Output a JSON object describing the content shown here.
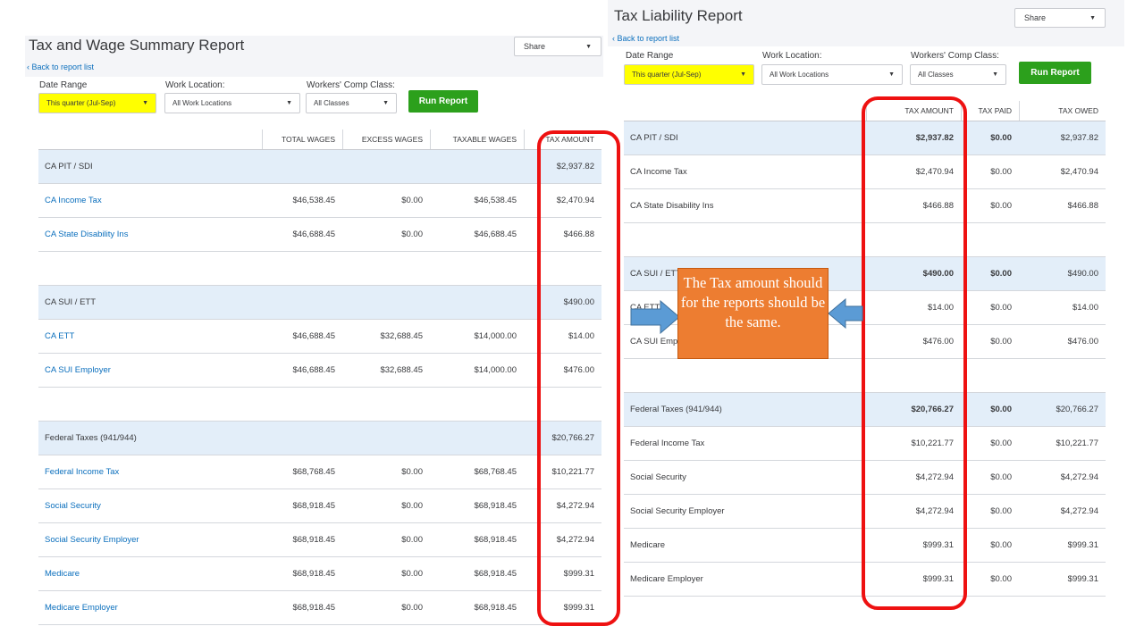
{
  "left": {
    "title": "Tax and Wage Summary Report",
    "back": "Back to report list",
    "share": "Share",
    "filters": {
      "date_label": "Date Range",
      "date_value": "This quarter (Jul-Sep)",
      "loc_label": "Work Location:",
      "loc_value": "All Work Locations",
      "comp_label": "Workers' Comp Class:",
      "comp_value": "All Classes",
      "run": "Run Report"
    },
    "columns": [
      "TOTAL WAGES",
      "EXCESS WAGES",
      "TAXABLE WAGES",
      "TAX AMOUNT"
    ],
    "rows": [
      {
        "type": "group",
        "name": "CA PIT / SDI",
        "vals": [
          "",
          "",
          "",
          "$2,937.82"
        ]
      },
      {
        "type": "item",
        "name": "CA Income Tax",
        "vals": [
          "$46,538.45",
          "$0.00",
          "$46,538.45",
          "$2,470.94"
        ]
      },
      {
        "type": "item",
        "name": "CA State Disability Ins",
        "vals": [
          "$46,688.45",
          "$0.00",
          "$46,688.45",
          "$466.88"
        ]
      },
      {
        "type": "blank"
      },
      {
        "type": "group",
        "name": "CA SUI / ETT",
        "vals": [
          "",
          "",
          "",
          "$490.00"
        ]
      },
      {
        "type": "item",
        "name": "CA ETT",
        "vals": [
          "$46,688.45",
          "$32,688.45",
          "$14,000.00",
          "$14.00"
        ]
      },
      {
        "type": "item",
        "name": "CA SUI Employer",
        "vals": [
          "$46,688.45",
          "$32,688.45",
          "$14,000.00",
          "$476.00"
        ]
      },
      {
        "type": "blank"
      },
      {
        "type": "group",
        "name": "Federal Taxes (941/944)",
        "vals": [
          "",
          "",
          "",
          "$20,766.27"
        ]
      },
      {
        "type": "item",
        "name": "Federal Income Tax",
        "vals": [
          "$68,768.45",
          "$0.00",
          "$68,768.45",
          "$10,221.77"
        ]
      },
      {
        "type": "item",
        "name": "Social Security",
        "vals": [
          "$68,918.45",
          "$0.00",
          "$68,918.45",
          "$4,272.94"
        ]
      },
      {
        "type": "item",
        "name": "Social Security Employer",
        "vals": [
          "$68,918.45",
          "$0.00",
          "$68,918.45",
          "$4,272.94"
        ]
      },
      {
        "type": "item",
        "name": "Medicare",
        "vals": [
          "$68,918.45",
          "$0.00",
          "$68,918.45",
          "$999.31"
        ]
      },
      {
        "type": "item",
        "name": "Medicare Employer",
        "vals": [
          "$68,918.45",
          "$0.00",
          "$68,918.45",
          "$999.31"
        ]
      }
    ]
  },
  "right": {
    "title": "Tax Liability Report",
    "back": "Back to report list",
    "share": "Share",
    "filters": {
      "date_label": "Date Range",
      "date_value": "This quarter (Jul-Sep)",
      "loc_label": "Work Location:",
      "loc_value": "All Work Locations",
      "comp_label": "Workers' Comp Class:",
      "comp_value": "All Classes",
      "run": "Run Report"
    },
    "columns": [
      "TAX AMOUNT",
      "TAX PAID",
      "TAX OWED"
    ],
    "rows": [
      {
        "type": "group",
        "name": "CA PIT / SDI",
        "vals": [
          "$2,937.82",
          "$0.00",
          "$2,937.82"
        ]
      },
      {
        "type": "item",
        "name": "CA Income Tax",
        "vals": [
          "$2,470.94",
          "$0.00",
          "$2,470.94"
        ]
      },
      {
        "type": "item",
        "name": "CA State Disability Ins",
        "vals": [
          "$466.88",
          "$0.00",
          "$466.88"
        ]
      },
      {
        "type": "blank"
      },
      {
        "type": "group",
        "name": "CA SUI / ETT",
        "vals": [
          "$490.00",
          "$0.00",
          "$490.00"
        ]
      },
      {
        "type": "item",
        "name": "CA ETT",
        "vals": [
          "$14.00",
          "$0.00",
          "$14.00"
        ]
      },
      {
        "type": "item",
        "name": "CA SUI Employer",
        "vals": [
          "$476.00",
          "$0.00",
          "$476.00"
        ]
      },
      {
        "type": "blank"
      },
      {
        "type": "group",
        "name": "Federal Taxes (941/944)",
        "vals": [
          "$20,766.27",
          "$0.00",
          "$20,766.27"
        ]
      },
      {
        "type": "item",
        "name": "Federal Income Tax",
        "vals": [
          "$10,221.77",
          "$0.00",
          "$10,221.77"
        ]
      },
      {
        "type": "item",
        "name": "Social Security",
        "vals": [
          "$4,272.94",
          "$0.00",
          "$4,272.94"
        ]
      },
      {
        "type": "item",
        "name": "Social Security Employer",
        "vals": [
          "$4,272.94",
          "$0.00",
          "$4,272.94"
        ]
      },
      {
        "type": "item",
        "name": "Medicare",
        "vals": [
          "$999.31",
          "$0.00",
          "$999.31"
        ]
      },
      {
        "type": "item",
        "name": "Medicare Employer",
        "vals": [
          "$999.31",
          "$0.00",
          "$999.31"
        ]
      }
    ]
  },
  "annotation": {
    "text": "The Tax amount should for the reports should be the same.",
    "box_color": "#ed7d31",
    "highlight_color": "#ee1111",
    "arrow_color": "#5b9bd5"
  }
}
